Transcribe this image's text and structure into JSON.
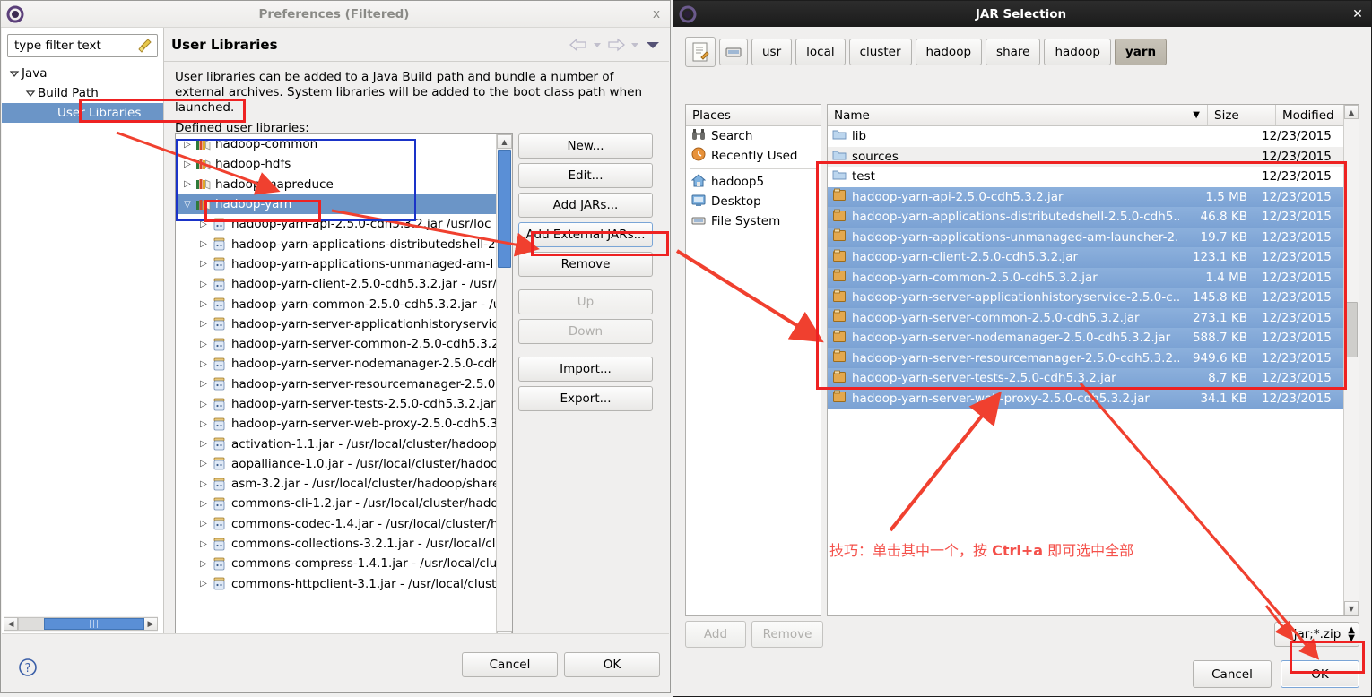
{
  "preferences": {
    "title": "Preferences (Filtered)",
    "close_label": "x",
    "filter_placeholder": "type filter text",
    "tree": [
      {
        "label": "Java",
        "level": 0,
        "expanded": true,
        "selected": false
      },
      {
        "label": "Build Path",
        "level": 1,
        "expanded": true,
        "selected": false
      },
      {
        "label": "User Libraries",
        "level": 2,
        "expanded": false,
        "selected": true
      }
    ],
    "page_title": "User Libraries",
    "description": "User libraries can be added to a Java Build path and bundle a number of external archives. System libraries will be added to the boot class path when launched.",
    "list_label": "Defined user libraries:",
    "libraries": [
      {
        "label": "hadoop-common",
        "type": "lib",
        "selected": false
      },
      {
        "label": "hadoop-hdfs",
        "type": "lib",
        "selected": false
      },
      {
        "label": "hadoop-mapreduce",
        "type": "lib",
        "selected": false
      },
      {
        "label": "hadoop-yarn",
        "type": "lib",
        "selected": true,
        "expanded": true
      },
      {
        "label": "hadoop-yarn-api-2.5.0-cdh5.3.2.jar  /usr/loc",
        "type": "jar",
        "selected": false
      },
      {
        "label": "hadoop-yarn-applications-distributedshell-2.",
        "type": "jar",
        "selected": false
      },
      {
        "label": "hadoop-yarn-applications-unmanaged-am-l",
        "type": "jar",
        "selected": false
      },
      {
        "label": "hadoop-yarn-client-2.5.0-cdh5.3.2.jar - /usr/l",
        "type": "jar",
        "selected": false
      },
      {
        "label": "hadoop-yarn-common-2.5.0-cdh5.3.2.jar - /u",
        "type": "jar",
        "selected": false
      },
      {
        "label": "hadoop-yarn-server-applicationhistoryservic",
        "type": "jar",
        "selected": false
      },
      {
        "label": "hadoop-yarn-server-common-2.5.0-cdh5.3.2",
        "type": "jar",
        "selected": false
      },
      {
        "label": "hadoop-yarn-server-nodemanager-2.5.0-cdh",
        "type": "jar",
        "selected": false
      },
      {
        "label": "hadoop-yarn-server-resourcemanager-2.5.0",
        "type": "jar",
        "selected": false
      },
      {
        "label": "hadoop-yarn-server-tests-2.5.0-cdh5.3.2.jar",
        "type": "jar",
        "selected": false
      },
      {
        "label": "hadoop-yarn-server-web-proxy-2.5.0-cdh5.3",
        "type": "jar",
        "selected": false
      },
      {
        "label": "activation-1.1.jar - /usr/local/cluster/hadoop,",
        "type": "jar",
        "selected": false
      },
      {
        "label": "aopalliance-1.0.jar - /usr/local/cluster/hadoo",
        "type": "jar",
        "selected": false
      },
      {
        "label": "asm-3.2.jar - /usr/local/cluster/hadoop/share",
        "type": "jar",
        "selected": false
      },
      {
        "label": "commons-cli-1.2.jar - /usr/local/cluster/hado",
        "type": "jar",
        "selected": false
      },
      {
        "label": "commons-codec-1.4.jar - /usr/local/cluster/h",
        "type": "jar",
        "selected": false
      },
      {
        "label": "commons-collections-3.2.1.jar - /usr/local/cl",
        "type": "jar",
        "selected": false
      },
      {
        "label": "commons-compress-1.4.1.jar - /usr/local/clu",
        "type": "jar",
        "selected": false
      },
      {
        "label": "commons-httpclient-3.1.jar - /usr/local/cluste",
        "type": "jar",
        "selected": false
      }
    ],
    "buttons": [
      {
        "label": "New...",
        "enabled": true
      },
      {
        "label": "Edit...",
        "enabled": true
      },
      {
        "label": "Add JARs...",
        "enabled": true
      },
      {
        "label": "Add External JARs...",
        "enabled": true,
        "focused": true
      },
      {
        "label": "Remove",
        "enabled": true
      },
      {
        "label": "Up",
        "enabled": false
      },
      {
        "label": "Down",
        "enabled": false
      },
      {
        "label": "Import...",
        "enabled": true
      },
      {
        "label": "Export...",
        "enabled": true
      }
    ],
    "footer": {
      "help": "?",
      "cancel": "Cancel",
      "ok": "OK"
    }
  },
  "jar_dialog": {
    "title": "JAR Selection",
    "close_label": "✕",
    "path_buttons": [
      {
        "label": "usr",
        "current": false
      },
      {
        "label": "local",
        "current": false
      },
      {
        "label": "cluster",
        "current": false
      },
      {
        "label": "hadoop",
        "current": false
      },
      {
        "label": "share",
        "current": false
      },
      {
        "label": "hadoop",
        "current": false
      },
      {
        "label": "yarn",
        "current": true
      }
    ],
    "places_header": "Places",
    "places": [
      {
        "label": "Search",
        "icon": "binoculars-icon"
      },
      {
        "label": "Recently Used",
        "icon": "clock-icon"
      },
      {
        "label": "hadoop5",
        "icon": "home-icon"
      },
      {
        "label": "Desktop",
        "icon": "desktop-icon"
      },
      {
        "label": "File System",
        "icon": "drive-icon"
      }
    ],
    "columns": {
      "name": "Name",
      "size": "Size",
      "modified": "Modified"
    },
    "files": [
      {
        "name": "lib",
        "size": "",
        "modified": "12/23/2015",
        "type": "folder",
        "selected": false
      },
      {
        "name": "sources",
        "size": "",
        "modified": "12/23/2015",
        "type": "folder",
        "selected": false
      },
      {
        "name": "test",
        "size": "",
        "modified": "12/23/2015",
        "type": "folder",
        "selected": false
      },
      {
        "name": "hadoop-yarn-api-2.5.0-cdh5.3.2.jar",
        "size": "1.5 MB",
        "modified": "12/23/2015",
        "type": "jar",
        "selected": true
      },
      {
        "name": "hadoop-yarn-applications-distributedshell-2.5.0-cdh5....",
        "size": "46.8 KB",
        "modified": "12/23/2015",
        "type": "jar",
        "selected": true
      },
      {
        "name": "hadoop-yarn-applications-unmanaged-am-launcher-2...",
        "size": "19.7 KB",
        "modified": "12/23/2015",
        "type": "jar",
        "selected": true
      },
      {
        "name": "hadoop-yarn-client-2.5.0-cdh5.3.2.jar",
        "size": "123.1 KB",
        "modified": "12/23/2015",
        "type": "jar",
        "selected": true
      },
      {
        "name": "hadoop-yarn-common-2.5.0-cdh5.3.2.jar",
        "size": "1.4 MB",
        "modified": "12/23/2015",
        "type": "jar",
        "selected": true
      },
      {
        "name": "hadoop-yarn-server-applicationhistoryservice-2.5.0-c...",
        "size": "145.8 KB",
        "modified": "12/23/2015",
        "type": "jar",
        "selected": true
      },
      {
        "name": "hadoop-yarn-server-common-2.5.0-cdh5.3.2.jar",
        "size": "273.1 KB",
        "modified": "12/23/2015",
        "type": "jar",
        "selected": true
      },
      {
        "name": "hadoop-yarn-server-nodemanager-2.5.0-cdh5.3.2.jar",
        "size": "588.7 KB",
        "modified": "12/23/2015",
        "type": "jar",
        "selected": true
      },
      {
        "name": "hadoop-yarn-server-resourcemanager-2.5.0-cdh5.3.2....",
        "size": "949.6 KB",
        "modified": "12/23/2015",
        "type": "jar",
        "selected": true
      },
      {
        "name": "hadoop-yarn-server-tests-2.5.0-cdh5.3.2.jar",
        "size": "8.7 KB",
        "modified": "12/23/2015",
        "type": "jar",
        "selected": true
      },
      {
        "name": "hadoop-yarn-server-web-proxy-2.5.0-cdh5.3.2.jar",
        "size": "34.1 KB",
        "modified": "12/23/2015",
        "type": "jar",
        "selected": true
      }
    ],
    "add_label": "Add",
    "remove_label": "Remove",
    "filter_value": "*.jar;*.zip",
    "cancel_label": "Cancel",
    "ok_label": "OK"
  },
  "annotation": {
    "tip_prefix": "技巧：单击其中一个，按 ",
    "tip_key": "Ctrl+a",
    "tip_suffix": " 即可选中全部",
    "highlight_color": "#ee2222",
    "group_color": "#1a33c8"
  }
}
